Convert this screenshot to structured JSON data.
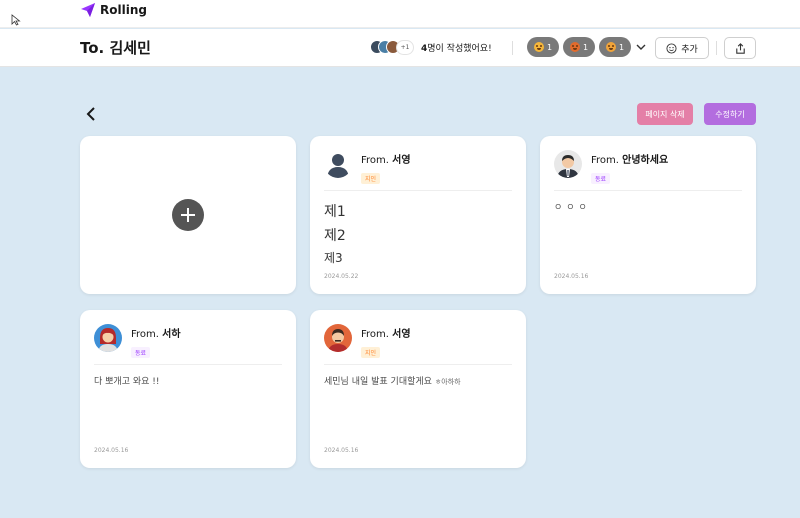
{
  "app": {
    "logo": "Rolling"
  },
  "header": {
    "recipient": "To. 김세민",
    "more_count": "+1",
    "writer_count": "4",
    "writer_suffix": "명이 작성했어요!",
    "reactions": [
      {
        "emoji": "grin-face-icon",
        "count": "1"
      },
      {
        "emoji": "angry-face-icon",
        "count": "1"
      },
      {
        "emoji": "crying-face-icon",
        "count": "1"
      }
    ],
    "add_label": "추가"
  },
  "actions": {
    "delete_label": "페이지 삭제",
    "edit_label": "수정하기"
  },
  "cards": [
    {
      "from_prefix": "From. ",
      "sender": "서영",
      "relationship": "지인",
      "content_lines": [
        "제1",
        "제2",
        "제3"
      ],
      "date": "2024.05.22"
    },
    {
      "from_prefix": "From. ",
      "sender": "안녕하세요",
      "relationship": "동료",
      "content": "ㅇㅇㅇ",
      "date": "2024.05.16"
    },
    {
      "from_prefix": "From. ",
      "sender": "서하",
      "relationship": "동료",
      "content": "다 뽀개고 와요 !!",
      "date": "2024.05.16"
    },
    {
      "from_prefix": "From. ",
      "sender": "서영",
      "relationship": "지인",
      "content": "세민님 내일 발표 기대할게요",
      "content_small": "ㅎ아하하",
      "date": "2024.05.16"
    }
  ],
  "colors": {
    "background": "#d9e8f3",
    "delete_button": "#e47fa7",
    "edit_button": "#b36ddf",
    "badge_gray": "#797979"
  }
}
